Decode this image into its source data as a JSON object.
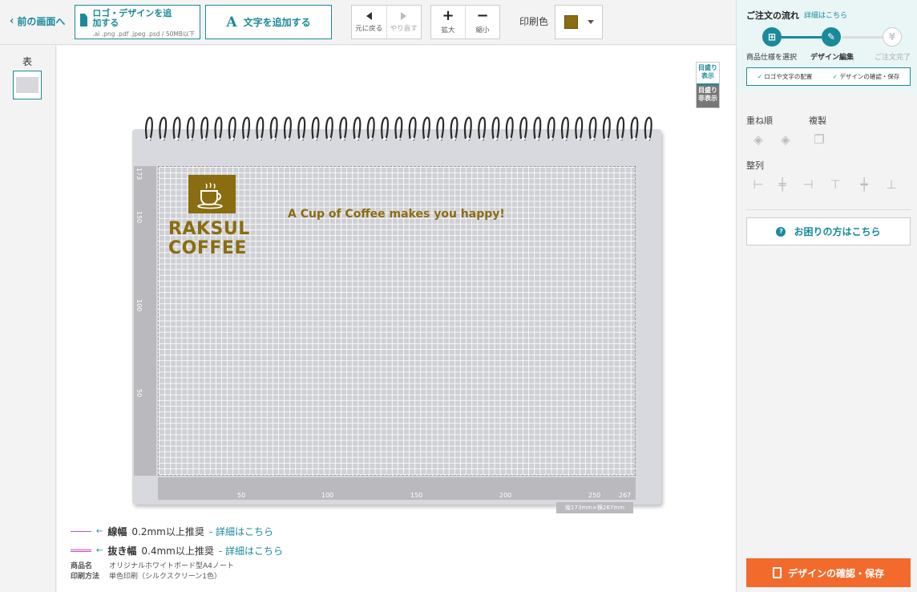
{
  "toolbar": {
    "back_label": "前の画面へ",
    "add_logo_label": "ロゴ・デザインを追加する",
    "add_logo_formats": ".ai .png .pdf .jpeg .psd / 50MB以下",
    "add_text_label": "文字を追加する",
    "undo_label": "元に戻る",
    "redo_label": "やり直す",
    "zoom_in_label": "拡大",
    "zoom_out_label": "縮小",
    "print_color_label": "印刷色",
    "print_color": "#8a6d10"
  },
  "pages_panel": {
    "face_label": "表"
  },
  "canvas": {
    "grid_toggle_on": "目盛り表示",
    "grid_toggle_off": "目盛り非表示",
    "ruler_left_ticks": [
      "173",
      "150",
      "100",
      "50"
    ],
    "ruler_bottom_ticks": [
      "50",
      "100",
      "150",
      "200",
      "250",
      "267"
    ],
    "dimension_badge": "縦173mm×横267mm",
    "design_logo_line1": "RAKSUL",
    "design_logo_line2": "COFFEE",
    "design_tagline": "A Cup of Coffee makes you happy!"
  },
  "legend": {
    "line_width_label": "線幅",
    "line_width_value": "0.2mm以上推奨",
    "knockout_label": "抜き幅",
    "knockout_value": "0.4mm以上推奨",
    "details_link": "- 詳細はこちら"
  },
  "product_info": {
    "name_key": "商品名",
    "name_value": "オリジナルホワイトボード型A4ノート",
    "method_key": "印刷方法",
    "method_value": "単色印刷（シルクスクリーン1色）"
  },
  "sidebar": {
    "flow_title": "ご注文の流れ",
    "flow_details_link": "詳細はこちら",
    "steps": [
      {
        "label": "商品仕様を選択",
        "state": "done"
      },
      {
        "label": "デザイン編集",
        "state": "current"
      },
      {
        "label": "ご注文完了",
        "state": "upcoming"
      }
    ],
    "checks": [
      "ロゴや文字の配置",
      "デザインの確認・保存"
    ],
    "layer_order_label": "重ね順",
    "duplicate_label": "複製",
    "align_label": "整列",
    "help_label": "お困りの方はこちら",
    "confirm_label": "デザインの確認・保存"
  },
  "colors": {
    "accent": "#1a8a99",
    "cta": "#f26b2d",
    "ink": "#8a6d10"
  },
  "icons": [
    "chevron-left-icon",
    "file-icon",
    "text-a-icon",
    "undo-icon",
    "redo-icon",
    "plus-icon",
    "minus-icon",
    "gift-icon",
    "pencil-icon",
    "yen-icon",
    "layer-front-icon",
    "layer-back-icon",
    "copy-icon",
    "align-left-icon",
    "align-center-h-icon",
    "align-right-icon",
    "align-top-icon",
    "align-center-v-icon",
    "align-bottom-icon",
    "question-icon",
    "document-search-icon"
  ]
}
